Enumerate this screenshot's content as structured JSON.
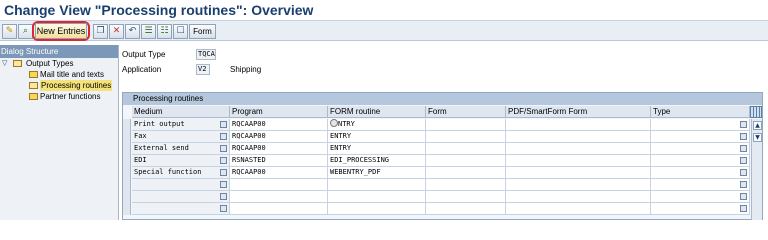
{
  "title": "Change View \"Processing routines\": Overview",
  "toolbar": {
    "new_entries_label": "New Entries",
    "form_label": "Form"
  },
  "dialog_structure": {
    "header": "Dialog Structure",
    "root": "Output Types",
    "children": [
      "Mail title and texts",
      "Processing routines",
      "Partner functions"
    ],
    "selected": "Processing routines"
  },
  "fields": {
    "output_type_label": "Output Type",
    "output_type_value": "TQCA",
    "application_label": "Application",
    "application_value": "V2",
    "application_desc": "Shipping"
  },
  "table": {
    "title": "Processing routines",
    "columns": [
      "Medium",
      "Program",
      "FORM routine",
      "Form",
      "PDF/SmartForm Form",
      "Type"
    ],
    "rows": [
      {
        "medium": "Print output",
        "program": "RQCAAP00",
        "form_routine": "ENTRY"
      },
      {
        "medium": "Fax",
        "program": "RQCAAP00",
        "form_routine": "ENTRY"
      },
      {
        "medium": "External send",
        "program": "RQCAAP00",
        "form_routine": "ENTRY"
      },
      {
        "medium": "EDI",
        "program": "RSNASTED",
        "form_routine": "EDI_PROCESSING"
      },
      {
        "medium": "Special function",
        "program": "RQCAAP00",
        "form_routine": "WEBENTRY_PDF"
      },
      {
        "medium": "",
        "program": "",
        "form_routine": ""
      },
      {
        "medium": "",
        "program": "",
        "form_routine": ""
      },
      {
        "medium": "",
        "program": "",
        "form_routine": ""
      }
    ]
  }
}
